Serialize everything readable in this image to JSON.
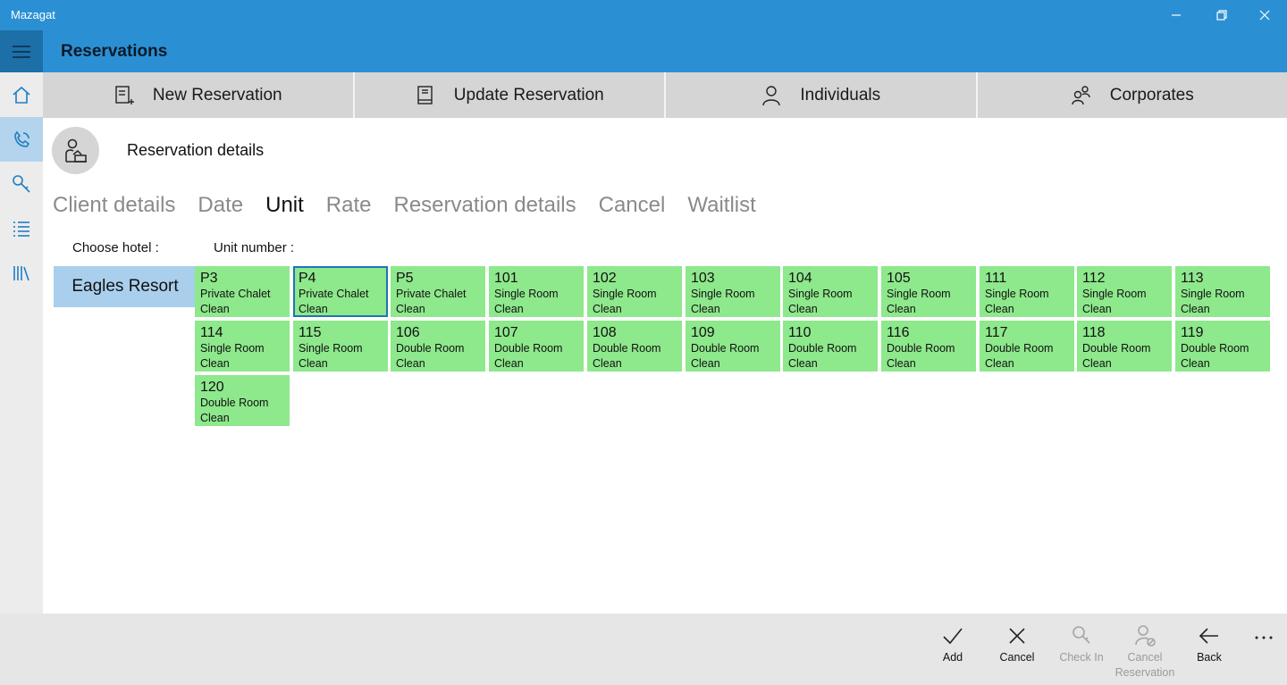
{
  "window": {
    "app_title": "Mazagat"
  },
  "header": {
    "title": "Reservations"
  },
  "sidebar": {
    "items": [
      {
        "icon": "home-icon"
      },
      {
        "icon": "phone-icon"
      },
      {
        "icon": "key-icon"
      },
      {
        "icon": "list-icon"
      },
      {
        "icon": "library-icon"
      }
    ]
  },
  "topnav": {
    "buttons": [
      {
        "label": "New Reservation",
        "icon": "new-document-icon"
      },
      {
        "label": "Update Reservation",
        "icon": "book-icon"
      },
      {
        "label": "Individuals",
        "icon": "person-icon"
      },
      {
        "label": "Corporates",
        "icon": "people-icon"
      }
    ]
  },
  "section": {
    "title": "Reservation details",
    "icon": "receptionist-icon"
  },
  "steps": [
    {
      "label": "Client details"
    },
    {
      "label": "Date"
    },
    {
      "label": "Unit",
      "active": true
    },
    {
      "label": "Rate"
    },
    {
      "label": "Reservation details"
    },
    {
      "label": "Cancel"
    },
    {
      "label": "Waitlist"
    }
  ],
  "form": {
    "hotel_label": "Choose hotel :",
    "unit_label": "Unit number :"
  },
  "hotels": [
    {
      "name": "Eagles Resort",
      "selected": true
    }
  ],
  "units": [
    {
      "number": "P3",
      "type": "Private Chalet",
      "status": "Clean"
    },
    {
      "number": "P4",
      "type": "Private Chalet",
      "status": "Clean",
      "selected": true
    },
    {
      "number": "P5",
      "type": "Private Chalet",
      "status": "Clean"
    },
    {
      "number": "101",
      "type": "Single Room",
      "status": "Clean"
    },
    {
      "number": "102",
      "type": "Single Room",
      "status": "Clean"
    },
    {
      "number": "103",
      "type": "Single Room",
      "status": "Clean"
    },
    {
      "number": "104",
      "type": "Single Room",
      "status": "Clean"
    },
    {
      "number": "105",
      "type": "Single Room",
      "status": "Clean"
    },
    {
      "number": "111",
      "type": "Single Room",
      "status": "Clean"
    },
    {
      "number": "112",
      "type": "Single Room",
      "status": "Clean"
    },
    {
      "number": "113",
      "type": "Single Room",
      "status": "Clean"
    },
    {
      "number": "114",
      "type": "Single Room",
      "status": "Clean"
    },
    {
      "number": "115",
      "type": "Single Room",
      "status": "Clean"
    },
    {
      "number": "106",
      "type": "Double Room",
      "status": "Clean"
    },
    {
      "number": "107",
      "type": "Double Room",
      "status": "Clean"
    },
    {
      "number": "108",
      "type": "Double Room",
      "status": "Clean"
    },
    {
      "number": "109",
      "type": "Double Room",
      "status": "Clean"
    },
    {
      "number": "110",
      "type": "Double Room",
      "status": "Clean"
    },
    {
      "number": "116",
      "type": "Double Room",
      "status": "Clean"
    },
    {
      "number": "117",
      "type": "Double Room",
      "status": "Clean"
    },
    {
      "number": "118",
      "type": "Double Room",
      "status": "Clean"
    },
    {
      "number": "119",
      "type": "Double Room",
      "status": "Clean"
    },
    {
      "number": "120",
      "type": "Double Room",
      "status": "Clean"
    }
  ],
  "commands": [
    {
      "label": "Add",
      "icon": "checkmark-icon",
      "enabled": true
    },
    {
      "label": "Cancel",
      "icon": "close-icon",
      "enabled": true
    },
    {
      "label": "Check In",
      "icon": "key-search-icon",
      "enabled": false
    },
    {
      "label": "Cancel Reservation",
      "icon": "person-cancel-icon",
      "enabled": false
    },
    {
      "label": "Back",
      "icon": "back-arrow-icon",
      "enabled": true
    }
  ],
  "more_label": "...",
  "colors": {
    "accent": "#2b90d3",
    "unit_clean": "#8ee88c",
    "selected_border": "#1f73b7",
    "hotel_selected": "#a9cfec"
  }
}
